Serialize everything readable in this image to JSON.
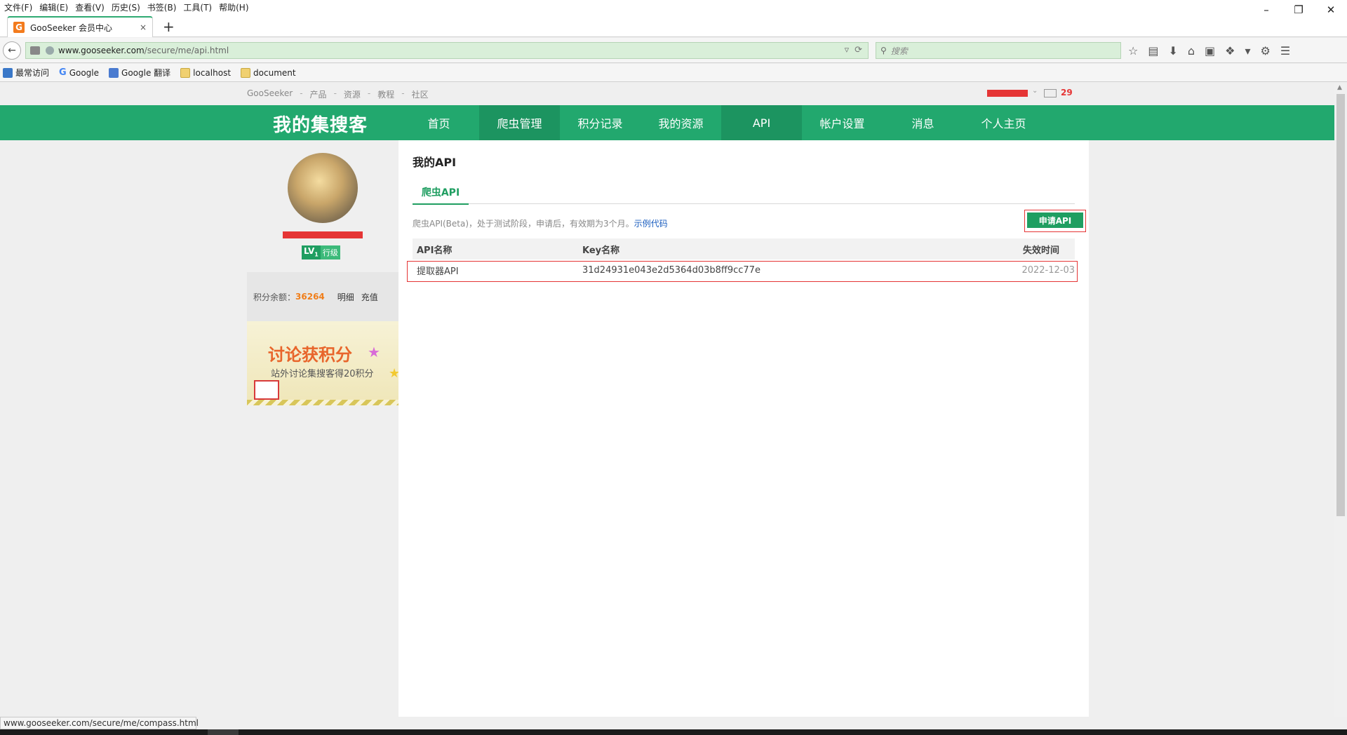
{
  "browser": {
    "menus": [
      "文件(F)",
      "编辑(E)",
      "查看(V)",
      "历史(S)",
      "书签(B)",
      "工具(T)",
      "帮助(H)"
    ],
    "window_controls": [
      "minimize-icon",
      "restore-icon",
      "close-icon"
    ],
    "tab": {
      "title": "GooSeeker 会员中心",
      "favicon_letter": "G",
      "close": "×"
    },
    "new_tab": "+",
    "url": {
      "host": "www.gooseeker.com",
      "path": "/secure/me/api.html"
    },
    "search_placeholder": "搜索",
    "bookmarks": [
      "最常访问",
      "Google",
      "Google 翻译",
      "localhost",
      "document"
    ]
  },
  "site": {
    "crumbs": [
      "GooSeeker",
      "产品",
      "资源",
      "教程",
      "社区"
    ],
    "mail_count": "29",
    "brand": "我的集搜客",
    "nav": [
      "首页",
      "爬虫管理",
      "积分记录",
      "我的资源",
      "API",
      "帐户设置",
      "消息",
      "个人主页"
    ],
    "active_nav": [
      "爬虫管理",
      "API"
    ]
  },
  "sidebar": {
    "level_badge": "LV",
    "level_sub": "1",
    "level_name": "行级",
    "points_label": "积分余额：",
    "points_value": "36264",
    "detail_link": "明细",
    "recharge_link": "充值",
    "banner_title": "讨论获积分",
    "banner_sub": "站外讨论集搜客得20积分"
  },
  "main": {
    "heading": "我的API",
    "subtab": "爬虫API",
    "description": "爬虫API(Beta)，处于测试阶段，申请后，有效期为3个月。",
    "example_link": "示例代码",
    "apply_button": "申请API",
    "table": {
      "headers": [
        "API名称",
        "Key名称",
        "失效时间"
      ],
      "rows": [
        {
          "name": "提取器API",
          "key": "31d24931e043e2d5364d03b8ff9cc77e",
          "expire": "2022-12-03"
        }
      ]
    }
  },
  "status_text": "www.gooseeker.com/secure/me/compass.html",
  "colors": {
    "brand_green": "#22a86e",
    "accent_orange": "#f07e1a",
    "highlight_red": "#e53535",
    "link_blue": "#1a5dbf"
  }
}
